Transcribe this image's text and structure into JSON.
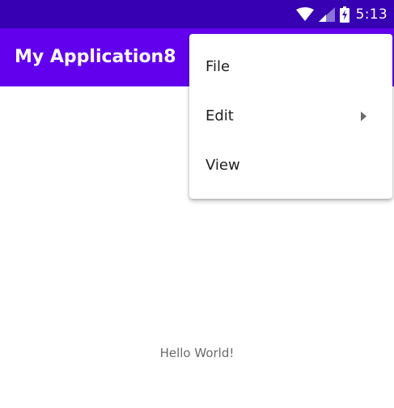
{
  "status_bar": {
    "time": "5:13",
    "icons": [
      "wifi-icon",
      "cellular-signal-icon",
      "battery-charging-icon"
    ],
    "background": "#3700b3"
  },
  "app_bar": {
    "title": "My Application8",
    "background": "#6200ee"
  },
  "content": {
    "message": "Hello World!"
  },
  "menu": {
    "items": [
      {
        "label": "File",
        "has_submenu": false
      },
      {
        "label": "Edit",
        "has_submenu": true,
        "submenu_icon": "chevron-right-icon"
      },
      {
        "label": "View",
        "has_submenu": false
      }
    ]
  }
}
